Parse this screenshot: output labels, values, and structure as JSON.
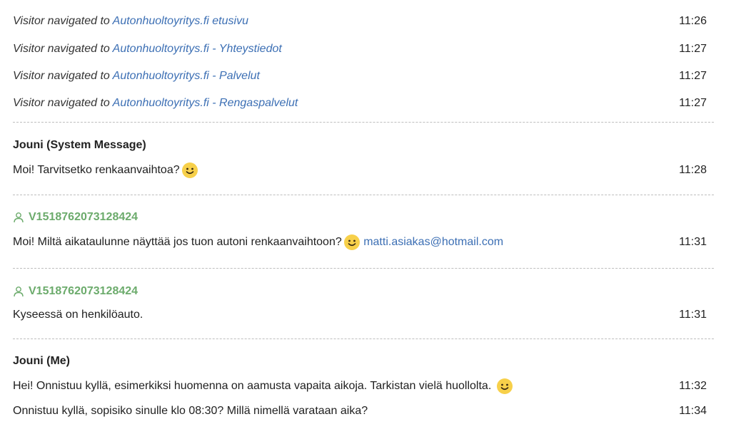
{
  "nav_events": [
    {
      "prefix": "Visitor navigated to",
      "link": "Autonhuoltoyritys.fi etusivu",
      "time": "11:26"
    },
    {
      "prefix": "Visitor navigated to",
      "link": "Autonhuoltoyritys.fi - Yhteystiedot",
      "time": "11:27"
    },
    {
      "prefix": "Visitor navigated to",
      "link": "Autonhuoltoyritys.fi - Palvelut",
      "time": "11:27"
    },
    {
      "prefix": "Visitor navigated to",
      "link": "Autonhuoltoyritys.fi - Rengaspalvelut",
      "time": "11:27"
    }
  ],
  "messages": [
    {
      "author": "Jouni (System Message)",
      "lines": [
        {
          "text": "Moi! Tarvitsetko renkaanvaihtoa?",
          "time": "11:28"
        }
      ]
    },
    {
      "author": "V1518762073128424",
      "lines": [
        {
          "text": "Moi! Miltä aikataulunne näyttää jos tuon autoni renkaanvaihtoon?",
          "email": "matti.asiakas@hotmail.com",
          "time": "11:31"
        }
      ]
    },
    {
      "author": "V1518762073128424",
      "lines": [
        {
          "text": "Kyseessä on henkilöauto.",
          "time": "11:31"
        }
      ]
    },
    {
      "author": "Jouni (Me)",
      "lines": [
        {
          "text": "Hei! Onnistuu kyllä, esimerkiksi huomenna on aamusta vapaita aikoja. Tarkistan vielä huollolta.",
          "time": "11:32"
        },
        {
          "text": "Onnistuu kyllä, sopisiko sinulle klo 08:30? Millä nimellä varataan aika?",
          "time": "11:34"
        }
      ]
    }
  ],
  "colors": {
    "link": "#3c6fb4",
    "visitor": "#6cab6c",
    "emoji": "#f7d04a"
  },
  "icons": {
    "visitor": "person-icon",
    "emoji": "smiley-icon"
  }
}
